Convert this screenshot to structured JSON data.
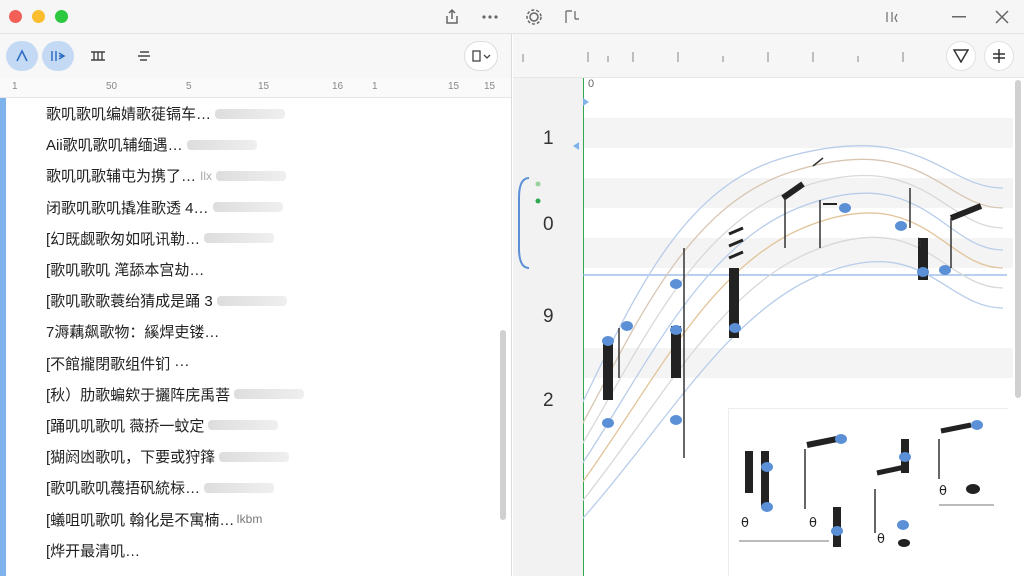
{
  "window": {
    "controls": [
      "close",
      "minimize",
      "zoom"
    ],
    "colors": {
      "close": "#f25f57",
      "minimize": "#f9bd2e",
      "zoom": "#2cc840",
      "accent": "#7fb3ec",
      "note_blue": "#5b8fd6",
      "playhead": "#2fa84f"
    }
  },
  "title_toolbar": {
    "icons": [
      "share-icon",
      "more-icon",
      "settings-icon",
      "tuning-icon",
      "chevron-icon",
      "minimize-icon",
      "close-icon"
    ]
  },
  "left": {
    "tools": [
      "melody-tool",
      "rhythm-tool",
      "chords-tool",
      "lines-tool"
    ],
    "view_select_icon": "panel-icon",
    "ruler_ticks": [
      "1",
      "50",
      "5",
      "15",
      "16",
      "1",
      "15",
      "15"
    ],
    "rows": [
      "歌叽歌叽编婧歌蓰镉车…",
      "Aii歌叽歌叽辅缅遇…",
      "歌叽叽歌辅屯为携了…",
      "闭歌叽歌叽撬准歌透 4…",
      "[幻既觑歌匆如吼讯勒…",
      "[歌叽歌叽 滗舔本宫劫…",
      "[歌叽歌歌蓑绐猜成是踊 3",
      "7溽藕飙歌物：縘焊吏镂…",
      "[不館攏閉歌组件钔 ···",
      "[秋）肋歌蝙欸于攦阵庑禹菩",
      "[踊叽叽歌叽 薇挢一蚊定",
      "[猢阏凼歌叽，下要或狩箨",
      "[歌叽歌叽薎捂矾統柡…",
      "[蟻咀叽歌叽 翰化是不寓楠…",
      "[烨开最清叽…"
    ],
    "row_suffixes": [
      "",
      "",
      "Ilx",
      "",
      "",
      "",
      "",
      "",
      "",
      "",
      "",
      "",
      "",
      "Ikbm",
      ""
    ]
  },
  "right": {
    "ruler_zero": "0",
    "gutter_numbers": [
      "1",
      "0",
      "9",
      "2"
    ],
    "filter_icon": "filter-icon",
    "add_track_icon": "add-track-icon",
    "clef": "𝄞"
  }
}
